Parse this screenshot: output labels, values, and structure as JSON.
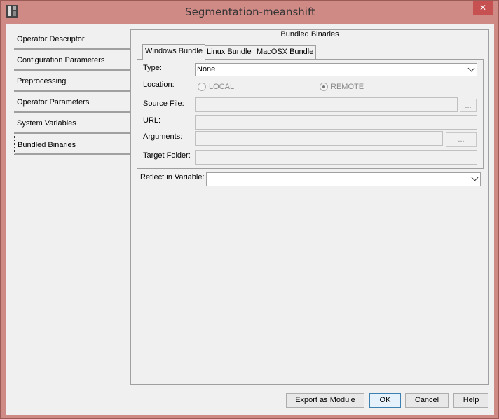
{
  "window": {
    "title": "Segmentation-meanshift",
    "close_glyph": "✕"
  },
  "sidebar": {
    "items": [
      {
        "label": "Operator Descriptor"
      },
      {
        "label": "Configuration Parameters"
      },
      {
        "label": "Preprocessing"
      },
      {
        "label": "Operator Parameters"
      },
      {
        "label": "System Variables"
      },
      {
        "label": "Bundled Binaries"
      }
    ]
  },
  "main": {
    "group_title": "Bundled Binaries",
    "tabs": [
      {
        "label": "Windows Bundle"
      },
      {
        "label": "Linux Bundle"
      },
      {
        "label": "MacOSX Bundle"
      }
    ],
    "form": {
      "type_label": "Type:",
      "type_value": "None",
      "location_label": "Location:",
      "local_label": "LOCAL",
      "remote_label": "REMOTE",
      "source_file_label": "Source File:",
      "url_label": "URL:",
      "arguments_label": "Arguments:",
      "target_folder_label": "Target Folder:",
      "browse_label": "..."
    },
    "reflect_label": "Reflect in Variable:"
  },
  "buttons": {
    "export": "Export as Module",
    "ok": "OK",
    "cancel": "Cancel",
    "help": "Help"
  }
}
